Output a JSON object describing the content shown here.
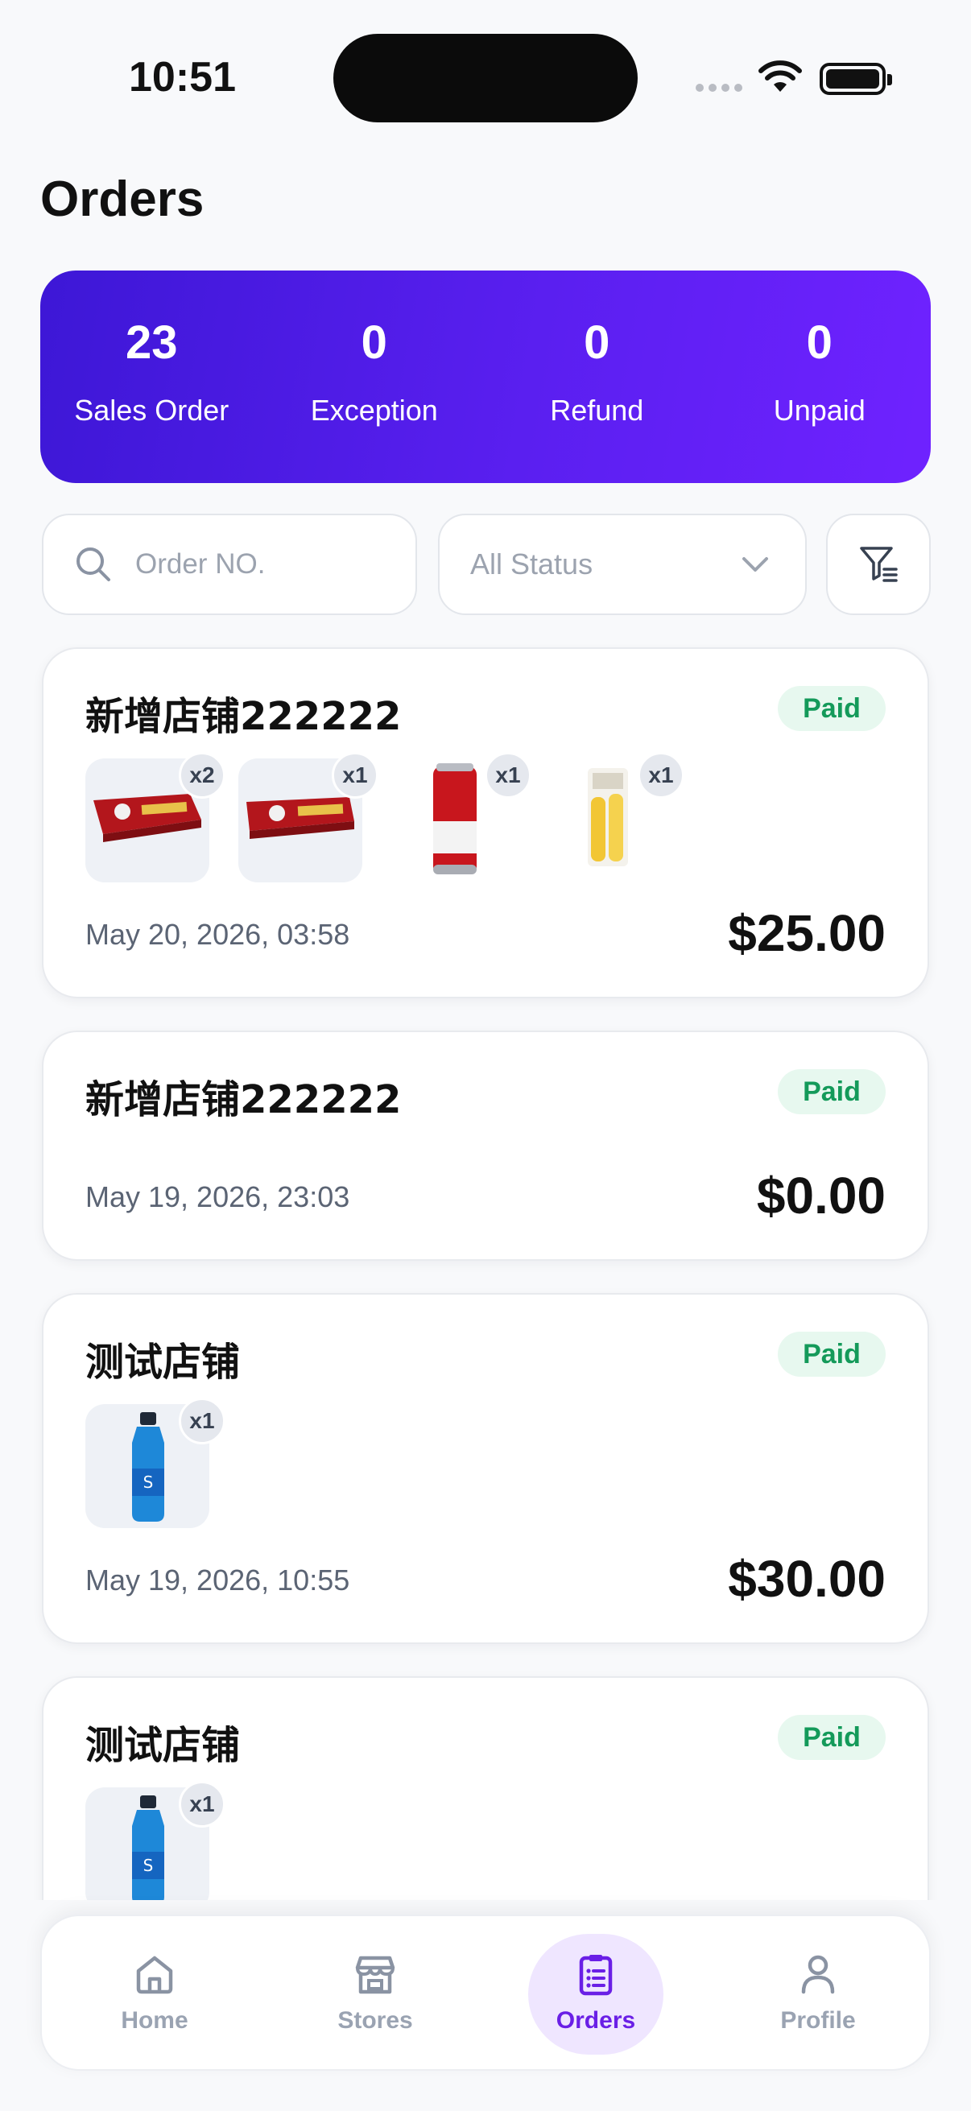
{
  "status_bar": {
    "time": "10:51"
  },
  "page": {
    "title": "Orders"
  },
  "summary": [
    {
      "value": "23",
      "label": "Sales Order"
    },
    {
      "value": "0",
      "label": "Exception"
    },
    {
      "value": "0",
      "label": "Refund"
    },
    {
      "value": "0",
      "label": "Unpaid"
    }
  ],
  "filters": {
    "search_placeholder": "Order NO.",
    "search_value": "",
    "status_selected": "All Status"
  },
  "orders": [
    {
      "store": "新增店铺222222",
      "status": "Paid",
      "date": "May 20, 2026, 03:58",
      "total": "$25.00",
      "items": [
        {
          "product_icon": "cigarette-carton",
          "qty": "x2"
        },
        {
          "product_icon": "cigarette-carton",
          "qty": "x1"
        },
        {
          "product_icon": "beer-can",
          "qty": "x1"
        },
        {
          "product_icon": "snack-bag",
          "qty": "x1"
        }
      ]
    },
    {
      "store": "新增店铺222222",
      "status": "Paid",
      "date": "May 19, 2026, 23:03",
      "total": "$0.00",
      "items": []
    },
    {
      "store": "测试店铺",
      "status": "Paid",
      "date": "May 19, 2026, 10:55",
      "total": "$30.00",
      "items": [
        {
          "product_icon": "sports-drink-bottle",
          "qty": "x1"
        }
      ]
    },
    {
      "store": "测试店铺",
      "status": "Paid",
      "items": [
        {
          "product_icon": "sports-drink-bottle",
          "qty": "x1"
        }
      ]
    }
  ],
  "nav": [
    {
      "label": "Home",
      "icon": "home-icon"
    },
    {
      "label": "Stores",
      "icon": "store-icon"
    },
    {
      "label": "Orders",
      "icon": "clipboard-list-icon",
      "active": true
    },
    {
      "label": "Profile",
      "icon": "user-icon"
    }
  ],
  "colors": {
    "accent": "#6a1fe6",
    "summary_gradient_start": "#3d17d6",
    "summary_gradient_end": "#6f22ff",
    "paid_badge_bg": "#e7f8ef",
    "paid_badge_text": "#149a5a"
  }
}
